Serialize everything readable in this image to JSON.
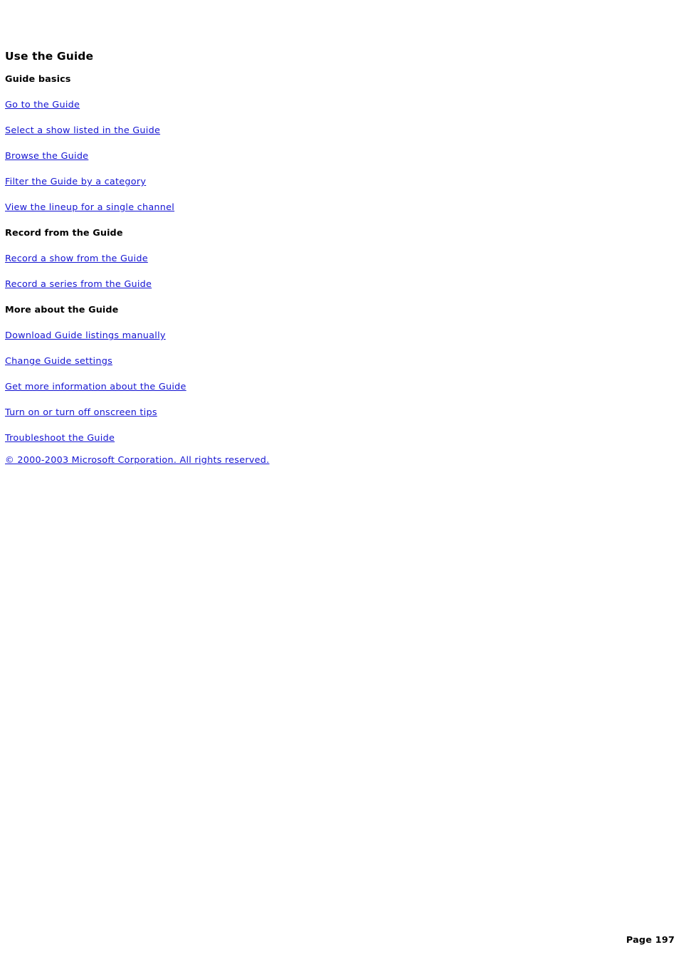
{
  "document": {
    "title": "Use the Guide",
    "page_label": "Page 197",
    "link_color": "#1414d2",
    "text_color": "#000000",
    "background_color": "#ffffff"
  },
  "sections": [
    {
      "heading": "Guide basics",
      "links": [
        "Go to the Guide",
        "Select a show listed in the Guide",
        "Browse the Guide",
        "Filter the Guide by a category",
        "View the lineup for a single channel"
      ]
    },
    {
      "heading": "Record from the Guide",
      "links": [
        "Record a show from the Guide",
        "Record a series from the Guide"
      ]
    },
    {
      "heading": "More about the Guide",
      "links": [
        "Download Guide listings manually",
        "Change Guide settings",
        "Get more information about the Guide",
        "Turn on or turn off onscreen tips",
        "Troubleshoot the Guide"
      ]
    }
  ],
  "copyright": "© 2000-2003 Microsoft Corporation. All rights reserved."
}
